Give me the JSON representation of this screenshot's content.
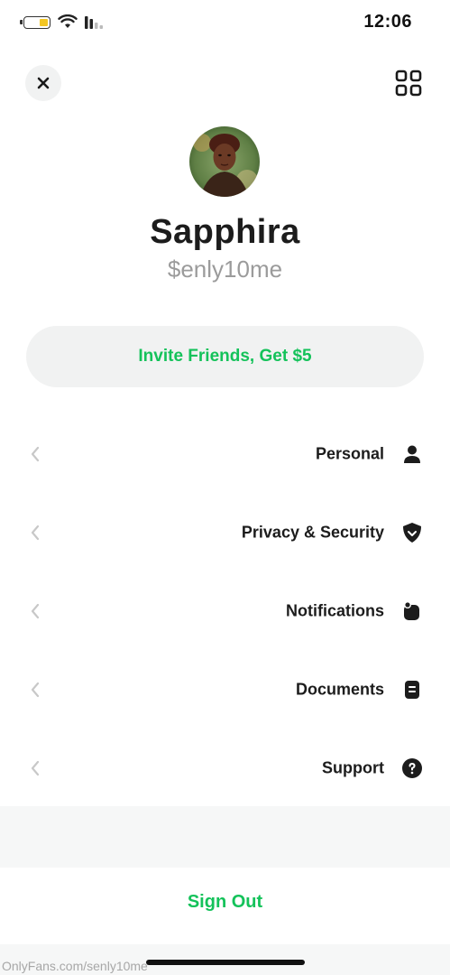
{
  "status_bar": {
    "time": "12:06",
    "battery_color": "#f3c623"
  },
  "header": {
    "close_icon": "close-icon",
    "qr_icon": "qr-code-icon"
  },
  "profile": {
    "display_name": "Sapphira",
    "handle": "$enly10me"
  },
  "invite": {
    "label": "Invite Friends, Get $5"
  },
  "menu": {
    "items": [
      {
        "label": "Personal",
        "icon": "person-icon"
      },
      {
        "label": "Privacy & Security",
        "icon": "shield-icon"
      },
      {
        "label": "Notifications",
        "icon": "notification-icon"
      },
      {
        "label": "Documents",
        "icon": "document-icon"
      },
      {
        "label": "Support",
        "icon": "help-icon"
      }
    ]
  },
  "sign_out": {
    "label": "Sign Out"
  },
  "watermark": {
    "text": "OnlyFans.com/senly10me"
  },
  "colors": {
    "accent": "#14c25a",
    "pill_background": "#f1f2f2",
    "text_primary": "#1c1c1c",
    "text_secondary": "#9b9b9b"
  }
}
